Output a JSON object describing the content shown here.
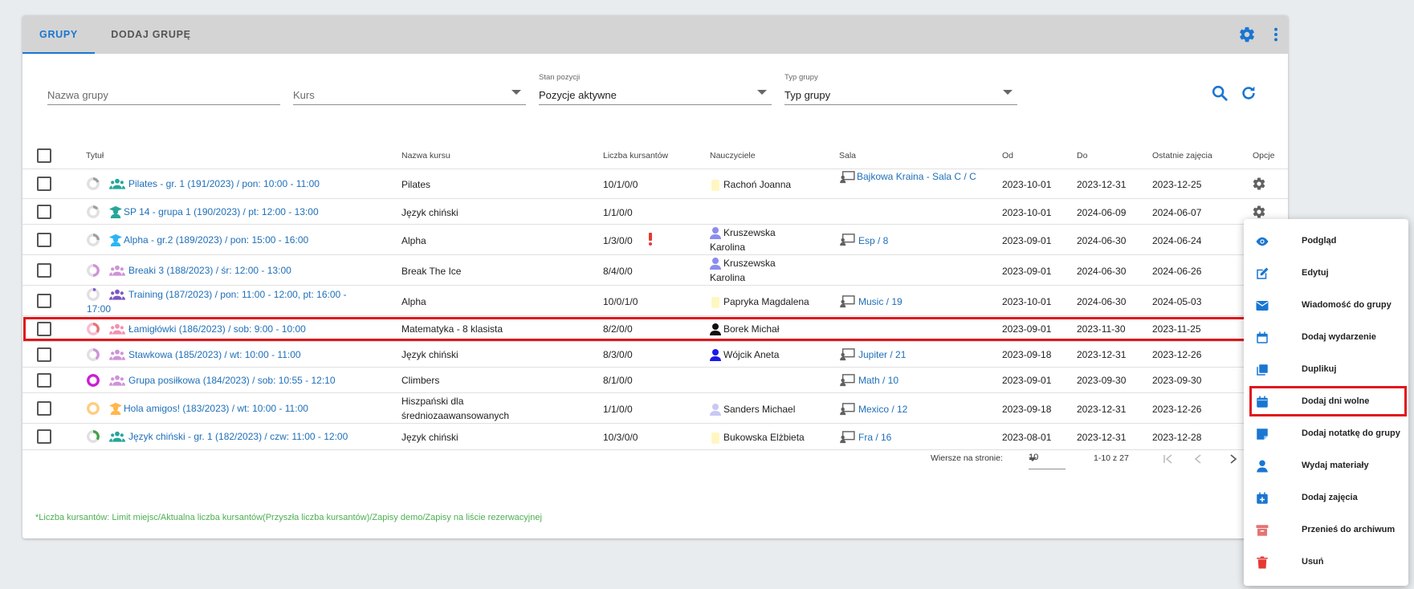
{
  "tabs": [
    {
      "label": "GRUPY"
    },
    {
      "label": "DODAJ GRUPĘ"
    }
  ],
  "filters": {
    "group_name": {
      "placeholder": "Nazwa grupy"
    },
    "course": {
      "placeholder": "Kurs"
    },
    "position_state": {
      "label": "Stan pozycji",
      "value": "Pozycje aktywne"
    },
    "group_type": {
      "label": "Typ grupy",
      "value": "Typ grupy"
    }
  },
  "columns": {
    "title": "Tytuł",
    "course": "Nazwa kursu",
    "count": "Liczba kursantów",
    "teachers": "Nauczyciele",
    "room": "Sala",
    "from": "Od",
    "to": "Do",
    "last": "Ostatnie zajęcia",
    "options": "Opcje"
  },
  "rows": [
    {
      "title": "Pilates - gr. 1 (191/2023) / pon: 10:00 - 11:00",
      "course": "Pilates",
      "count": "10/1/0/0",
      "teacher": "Rachoń Joanna",
      "room": "Bajkowa Kraina - Sala C / C",
      "from": "2023-10-01",
      "to": "2023-12-31",
      "last": "2023-12-25"
    },
    {
      "title": "SP 14 - grupa 1 (190/2023) / pt: 12:00 - 13:00",
      "course": "Język chiński",
      "count": "1/1/0/0",
      "teacher": "",
      "room": "",
      "from": "2023-10-01",
      "to": "2024-06-09",
      "last": "2024-06-07"
    },
    {
      "title": "Alpha - gr.2 (189/2023) / pon: 15:00 - 16:00",
      "course": "Alpha",
      "count": "1/3/0/0",
      "teacher": "Kruszewska Karolina",
      "room": "Esp / 8",
      "from": "2023-09-01",
      "to": "2024-06-30",
      "last": "2024-06-24"
    },
    {
      "title": "Breaki 3 (188/2023) / śr: 12:00 - 13:00",
      "course": "Break The Ice",
      "count": "8/4/0/0",
      "teacher": "Kruszewska Karolina",
      "room": "",
      "from": "2023-09-01",
      "to": "2024-06-30",
      "last": "2024-06-26"
    },
    {
      "title": "Training (187/2023) / pon: 11:00 - 12:00, pt: 16:00 - 17:00",
      "course": "Alpha",
      "count": "10/0/1/0",
      "teacher": "Papryka Magdalena",
      "room": "Music / 19",
      "from": "2023-10-01",
      "to": "2024-06-30",
      "last": "2024-05-03"
    },
    {
      "title": "Łamigłówki (186/2023) / sob: 9:00 - 10:00",
      "course": "Matematyka - 8 klasista",
      "count": "8/2/0/0",
      "teacher": "Borek Michał",
      "room": "",
      "from": "2023-09-01",
      "to": "2023-11-30",
      "last": "2023-11-25"
    },
    {
      "title": "Stawkowa (185/2023) / wt: 10:00 - 11:00",
      "course": "Język chiński",
      "count": "8/3/0/0",
      "teacher": "Wójcik Aneta",
      "room": "Jupiter / 21",
      "from": "2023-09-18",
      "to": "2023-12-31",
      "last": "2023-12-26"
    },
    {
      "title": "Grupa posiłkowa (184/2023) / sob: 10:55 - 12:10",
      "course": "Climbers",
      "count": "8/1/0/0",
      "teacher": "",
      "room": "Math / 10",
      "from": "2023-09-01",
      "to": "2023-09-30",
      "last": "2023-09-30"
    },
    {
      "title": "Hola amigos! (183/2023) / wt: 10:00 - 11:00",
      "course": "Hiszpański dla średniozaawansowanych",
      "count": "1/1/0/0",
      "teacher": "Sanders Michael",
      "room": "Mexico / 12",
      "from": "2023-09-18",
      "to": "2023-12-31",
      "last": "2023-12-26"
    },
    {
      "title": "Język chiński - gr. 1 (182/2023) / czw: 11:00 - 12:00",
      "course": "Język chiński",
      "count": "10/3/0/0",
      "teacher": "Bukowska Elżbieta",
      "room": "Fra / 16",
      "from": "2023-08-01",
      "to": "2023-12-31",
      "last": "2023-12-28"
    }
  ],
  "pagination": {
    "rows_label": "Wiersze na stronie:",
    "rows_value": "10",
    "range": "1-10 z 27"
  },
  "footnote": "*Liczba kursantów: Limit miejsc/Aktualna liczba kursantów(Przyszła liczba kursantów)/Zapisy demo/Zapisy na liście rezerwacyjnej",
  "menu": [
    {
      "label": "Podgląd",
      "icon": "eye-icon"
    },
    {
      "label": "Edytuj",
      "icon": "edit-icon"
    },
    {
      "label": "Wiadomość do grupy",
      "icon": "mail-icon"
    },
    {
      "label": "Dodaj wydarzenie",
      "icon": "calendar-icon"
    },
    {
      "label": "Duplikuj",
      "icon": "copy-icon"
    },
    {
      "label": "Dodaj dni wolne",
      "icon": "calendar-icon"
    },
    {
      "label": "Dodaj notatkę do grupy",
      "icon": "note-icon"
    },
    {
      "label": "Wydaj materiały",
      "icon": "person-icon"
    },
    {
      "label": "Dodaj zajęcia",
      "icon": "calendar-plus-icon"
    },
    {
      "label": "Przenieś do archiwum",
      "icon": "archive-icon"
    },
    {
      "label": "Usuń",
      "icon": "trash-icon"
    }
  ],
  "colors": {
    "accent": "#1976d2",
    "link": "#1e6fb8",
    "highlight": "#e0151c",
    "footnote": "#4caf50",
    "delete": "#e53935",
    "archive": "#e57373"
  }
}
